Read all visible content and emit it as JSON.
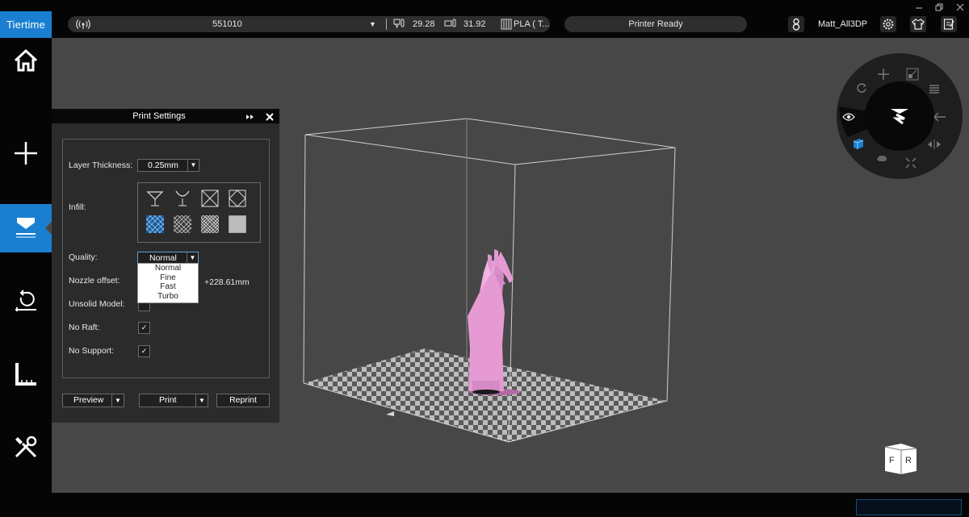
{
  "app": {
    "logo_text": "Tiertime"
  },
  "topbar": {
    "device_id": "551010",
    "nozzle_temp": "29.28",
    "bed_temp": "31.92",
    "material": "PLA ( T...",
    "status": "Printer Ready",
    "user_name": "Matt_All3DP"
  },
  "sidebar": {
    "items": [
      {
        "name": "home",
        "icon": "home-icon"
      },
      {
        "name": "add",
        "icon": "plus-icon"
      },
      {
        "name": "print",
        "icon": "print-icon",
        "active": true
      },
      {
        "name": "maintenance",
        "icon": "maintenance-icon"
      },
      {
        "name": "calibrate",
        "icon": "calibration-icon"
      },
      {
        "name": "tools",
        "icon": "tools-icon"
      }
    ],
    "active_color": "#1a7fd0"
  },
  "print_settings": {
    "title": "Print Settings",
    "layer_thickness_label": "Layer Thickness:",
    "layer_thickness_value": "0.25mm",
    "infill_label": "Infill:",
    "quality_label": "Quality:",
    "quality_value": "Normal",
    "quality_options": [
      "Normal",
      "Fine",
      "Fast",
      "Turbo"
    ],
    "nozzle_offset_label": "Nozzle offset:",
    "nozzle_offset_value": "+228.61mm",
    "unsolid_label": "Unsolid Model:",
    "no_raft_label": "No Raft:",
    "no_support_label": "No Support:",
    "checkmark": "✓",
    "preview_label": "Preview",
    "print_label": "Print",
    "reprint_label": "Reprint",
    "dropdown_arrow": "▼"
  },
  "view_cube": {
    "front": "F",
    "right": "R"
  },
  "colors": {
    "accent": "#1a7fd0",
    "model": "#e59ad4",
    "background": "#474747"
  }
}
